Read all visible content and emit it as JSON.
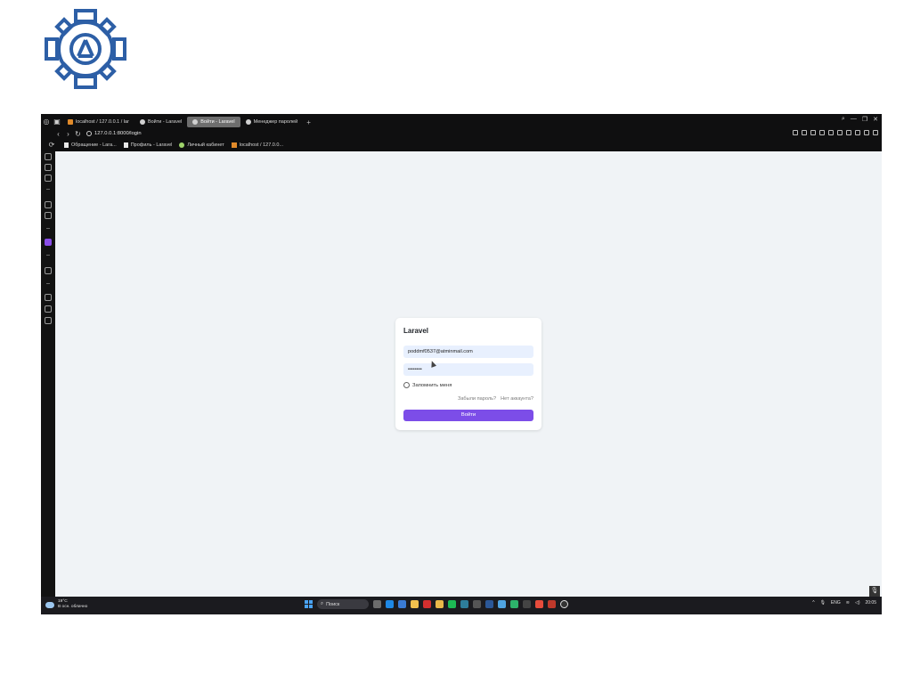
{
  "browser": {
    "tabs": [
      {
        "label": "localhost / 127.0.0.1 / lar",
        "active": false
      },
      {
        "label": "Войти - Laravel",
        "active": false
      },
      {
        "label": "Войти - Laravel",
        "active": true
      },
      {
        "label": "Менеджер паролей",
        "active": false
      }
    ],
    "url": "127.0.0.1:8000/login",
    "bookmarks": [
      "Обращение - Lara...",
      "Профиль - Laravel",
      "Личный кабинет",
      "localhost / 127.0.0..."
    ]
  },
  "login": {
    "title": "Laravel",
    "email_value": "poddmf0537@atminmail.com",
    "password_value": "••••••••",
    "remember_label": "Запомнить меня",
    "forgot_link": "Забыли пароль?",
    "no_account_link": "Нет аккаунта?",
    "submit_label": "Войти"
  },
  "taskbar": {
    "weather_temp": "19°C",
    "weather_desc": "В осн. облачно",
    "search_placeholder": "Поиск",
    "language": "ENG",
    "time": "20:05"
  },
  "colors": {
    "accent": "#7c4de8",
    "input_bg": "#e8f0fe",
    "page_bg": "#f0f3f6",
    "logo": "#2d5fa6"
  }
}
